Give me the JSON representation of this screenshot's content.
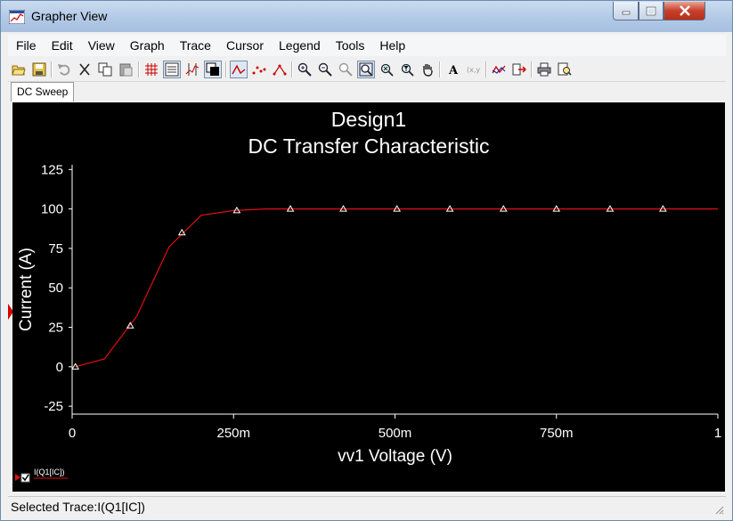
{
  "window": {
    "title": "Grapher View",
    "icon": "grapher-app-icon"
  },
  "menu": {
    "items": [
      "File",
      "Edit",
      "View",
      "Graph",
      "Trace",
      "Cursor",
      "Legend",
      "Tools",
      "Help"
    ]
  },
  "toolbar": {
    "buttons": [
      {
        "name": "open-icon"
      },
      {
        "name": "save-icon"
      },
      {
        "name": "undo-icon"
      },
      {
        "name": "cut-icon"
      },
      {
        "name": "copy-icon"
      },
      {
        "name": "paste-icon"
      },
      {
        "name": "grid-icon"
      },
      {
        "name": "legend-icon"
      },
      {
        "name": "cursors-icon"
      },
      {
        "name": "reverse-colors-icon"
      },
      {
        "name": "lines-icon"
      },
      {
        "name": "points-icon"
      },
      {
        "name": "lines-points-icon"
      },
      {
        "name": "zoom-in-icon"
      },
      {
        "name": "zoom-out-icon"
      },
      {
        "name": "zoom-area-icon"
      },
      {
        "name": "zoom-full-icon"
      },
      {
        "name": "zoom-x-icon"
      },
      {
        "name": "zoom-y-icon"
      },
      {
        "name": "pan-icon"
      },
      {
        "name": "font-icon"
      },
      {
        "name": "label-icon"
      },
      {
        "name": "add-trace-icon"
      },
      {
        "name": "export-icon"
      },
      {
        "name": "print-icon"
      },
      {
        "name": "print-preview-icon"
      }
    ]
  },
  "tabs": [
    {
      "label": "DC Sweep",
      "active": true
    }
  ],
  "status": {
    "text": "Selected Trace:I(Q1[IC])"
  },
  "colors": {
    "plot_background": "#000000",
    "trace": "#e01010",
    "axis": "#ffffff",
    "marker": "#ffffff"
  },
  "chart_data": {
    "type": "line",
    "title": "Design1",
    "subtitle": "DC Transfer Characteristic",
    "xlabel": "vv1 Voltage (V)",
    "ylabel": "Current (A)",
    "xlim": [
      0,
      1
    ],
    "ylim": [
      -30,
      128
    ],
    "xticks": [
      0,
      0.25,
      0.5,
      0.75,
      1
    ],
    "xtick_labels": [
      "0",
      "250m",
      "500m",
      "750m",
      "1"
    ],
    "yticks": [
      -25,
      0,
      25,
      50,
      75,
      100,
      125
    ],
    "ytick_labels": [
      "-25",
      "0",
      "25",
      "50",
      "75",
      "100",
      "125"
    ],
    "grid": false,
    "legend": {
      "position": "bottom-left",
      "entries": [
        "I(Q1[IC])"
      ],
      "checked": true
    },
    "series": [
      {
        "name": "I(Q1[IC])",
        "x": [
          0.005,
          0.05,
          0.1,
          0.15,
          0.2,
          0.25,
          0.3,
          0.35,
          0.4,
          0.45,
          0.5,
          0.55,
          0.6,
          0.65,
          0.7,
          0.75,
          0.8,
          0.85,
          0.9,
          0.95,
          1.0
        ],
        "y": [
          0,
          5,
          32,
          76,
          96,
          99,
          100,
          100,
          100,
          100,
          100,
          100,
          100,
          100,
          100,
          100,
          100,
          100,
          100,
          100,
          100
        ],
        "markers_x": [
          0.005,
          0.09,
          0.17,
          0.255,
          0.338,
          0.42,
          0.503,
          0.585,
          0.668,
          0.75,
          0.833,
          0.915
        ],
        "markers_y": [
          0,
          26,
          85,
          99,
          100,
          100,
          100,
          100,
          100,
          100,
          100,
          100
        ]
      }
    ]
  }
}
